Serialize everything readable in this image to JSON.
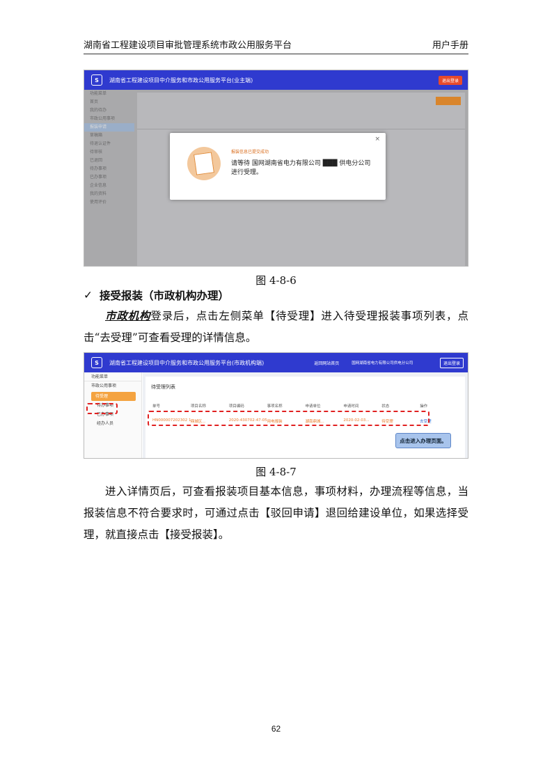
{
  "header": {
    "left": "湖南省工程建设项目审批管理系统市政公用服务平台",
    "right": "用户手册"
  },
  "screenshot1": {
    "title": "湖南省工程建设项目中介服务和市政公用服务平台(业主端)",
    "modal_top": "报装信息已提交成功",
    "modal_body": "请等待 国网湖南省电力有限公司 ███ 供电分公司 进行受理。",
    "sidebar": [
      "功能菜单",
      "首页",
      "我的待办",
      "市政公用事项",
      "报装申请",
      "草稿箱",
      "待退认证件",
      "待审核",
      "已退回",
      "待办事项",
      "已办事项",
      "企业信息",
      "我的资料",
      "使用评价"
    ]
  },
  "caption1": "图 4-8-6",
  "section_heading": {
    "check": "✓",
    "text": "接受报装（市政机构办理）"
  },
  "paragraph1": {
    "link": "市政机构",
    "text": "登录后，点击左侧菜单【待受理】进入待受理报装事项列表，点击“去受理”可查看受理的详情信息。"
  },
  "screenshot2": {
    "title": "湖南省工程建设项目中介服务和市政公用服务平台(市政机构端)",
    "back_home": "返回网站首页",
    "user": "国网湖南省电力有限公司供电分公司",
    "logout": "退出登录",
    "sidebar": [
      "功能菜单",
      "市政公用事项",
      "待受理",
      "待办事项",
      "已办事项",
      "经办人员"
    ],
    "list_title": "待受理列表",
    "columns": [
      "单号",
      "项目名称",
      "项目编码",
      "事项名称",
      "申请单位",
      "申请时间",
      "状态",
      "操作"
    ],
    "row": [
      "HN000007202302 10...",
      "鼎城区...",
      "2020-430702-47-05-...",
      "用电报装",
      "湖南鼎城...",
      "2020-02-03...",
      "待受理",
      "去受理"
    ],
    "callout": "点击进入办理页面。"
  },
  "caption2": "图 4-8-7",
  "paragraph2": "进入详情页后，可查看报装项目基本信息，事项材料，办理流程等信息，当报装信息不符合要求时，可通过点击【驳回申请】退回给建设单位，如果选择受理，就直接点击【接受报装】。",
  "page_number": "62",
  "colors": {
    "topbar": "#2f3acf",
    "accent": "#f4a340",
    "highlight": "#e02020"
  }
}
